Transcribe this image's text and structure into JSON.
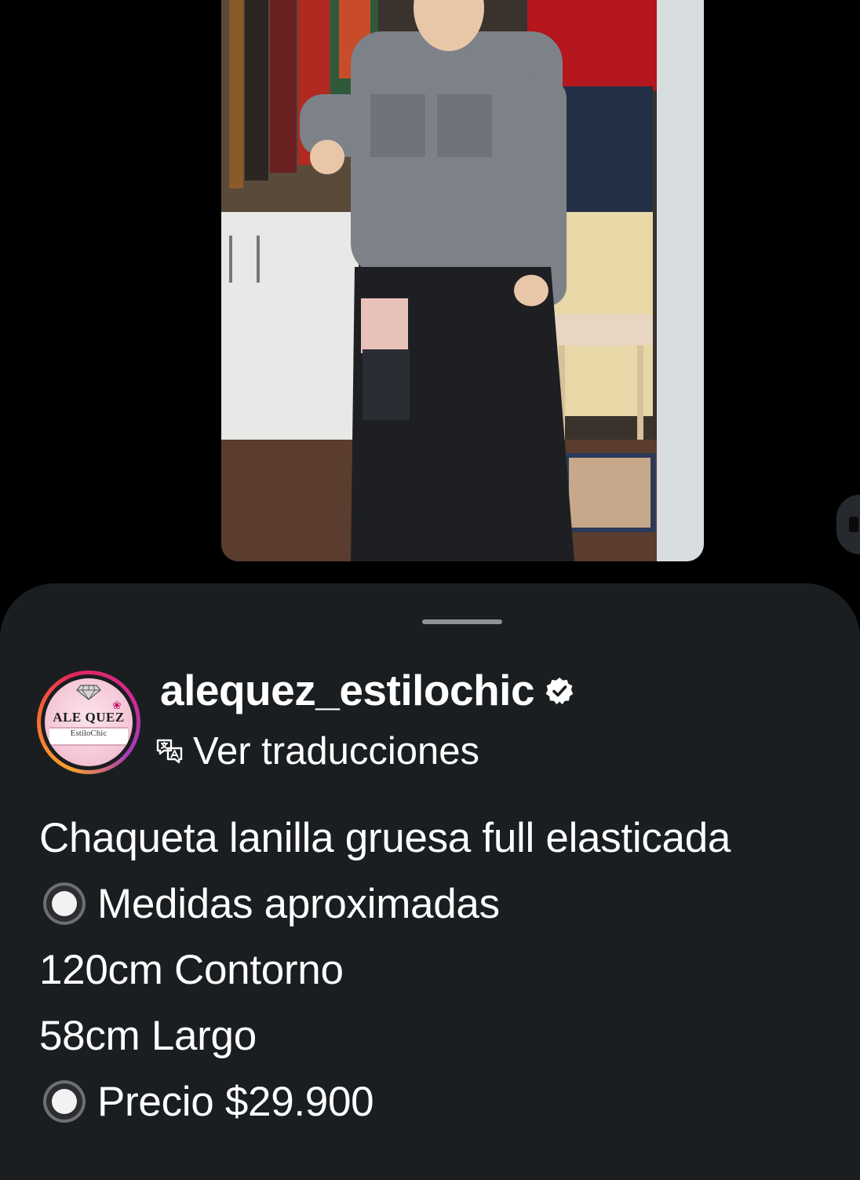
{
  "post": {
    "username": "alequez_estilochic",
    "verified": true,
    "translate_label": "Ver traducciones",
    "avatar": {
      "brand": "ALE QUEZ",
      "tagline": "EstiloChic"
    },
    "caption": [
      {
        "text": "Chaqueta lanilla gruesa full elasticada",
        "bullet": false
      },
      {
        "text": "Medidas aproximadas",
        "bullet": true
      },
      {
        "text": "120cm Contorno",
        "bullet": false
      },
      {
        "text": "58cm Largo",
        "bullet": false
      },
      {
        "text": "Precio $29.900",
        "bullet": true
      }
    ]
  },
  "icons": {
    "verified": "verified-check-icon",
    "translate": "translate-icon",
    "bullet": "radio-button-icon",
    "logo": "diamond-icon"
  },
  "colors": {
    "background": "#000000",
    "sheet": "#1b1e21",
    "text": "#ffffff",
    "story_ring_start": "#f9a12e",
    "story_ring_end": "#d02a8f"
  }
}
